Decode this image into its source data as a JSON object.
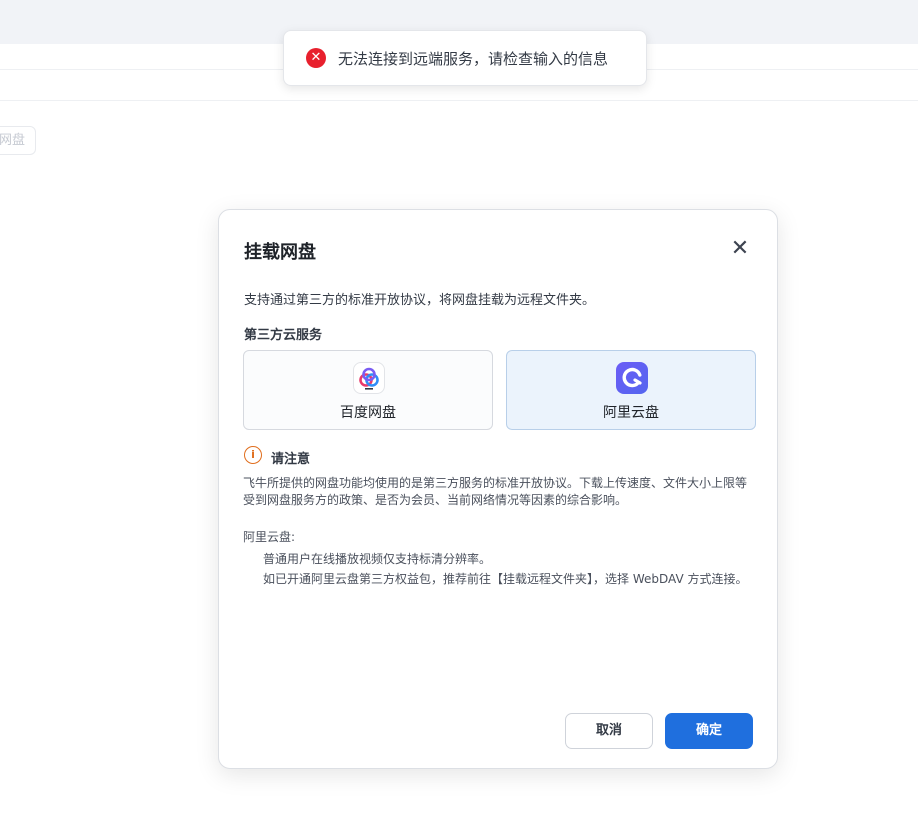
{
  "background": {
    "chip_label": "网盘"
  },
  "toast": {
    "message": "无法连接到远端服务，请检查输入的信息",
    "icon": "error-circle-icon",
    "icon_glyph": "✕",
    "color": "#e8202d"
  },
  "dialog": {
    "title": "挂载网盘",
    "close_glyph": "✕",
    "description": "支持通过第三方的标准开放协议，将网盘挂载为远程文件夹。",
    "section_label": "第三方云服务",
    "services": [
      {
        "label": "百度网盘",
        "icon": "baidu-netdisk-logo-icon",
        "selected": false
      },
      {
        "label": "阿里云盘",
        "icon": "aliyun-drive-logo-icon",
        "selected": true
      }
    ],
    "notice": {
      "icon_glyph": "i",
      "title": "请注意",
      "body": "飞牛所提供的网盘功能均使用的是第三方服务的标准开放协议。下载上传速度、文件大小上限等受到网盘服务方的政策、是否为会员、当前网络情况等因素的综合影响。",
      "ali_title": "阿里云盘:",
      "ali_lines": [
        "普通用户在线播放视频仅支持标清分辨率。",
        "如已开通阿里云盘第三方权益包，推荐前往【挂载远程文件夹】，选择 WebDAV 方式连接。"
      ]
    },
    "buttons": {
      "cancel": "取消",
      "confirm": "确定"
    },
    "colors": {
      "primary": "#1f6fde",
      "warning": "#e06d1c",
      "selected_bg": "#ebf3fc"
    }
  }
}
